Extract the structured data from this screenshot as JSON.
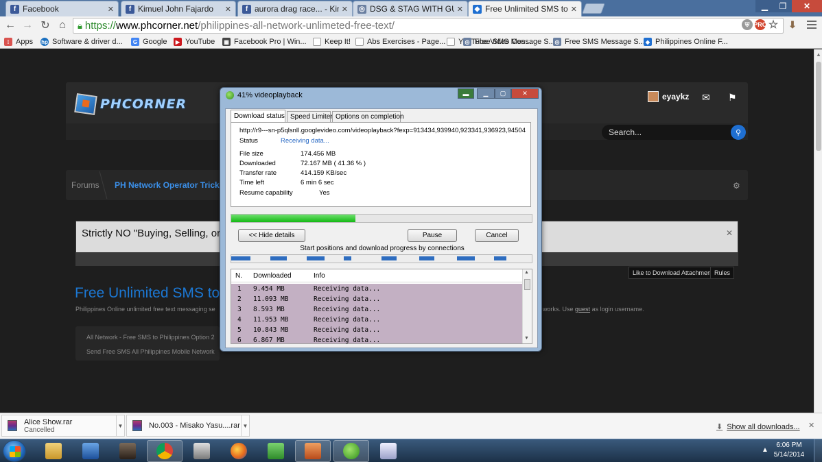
{
  "browser": {
    "tabs": [
      {
        "title": "Facebook",
        "icon": "facebook-icon",
        "color": "#3b5998",
        "glyph": "f"
      },
      {
        "title": "Kimuel John Fajardo",
        "icon": "facebook-icon",
        "color": "#3b5998",
        "glyph": "f"
      },
      {
        "title": "aurora drag race... - Kimue",
        "icon": "facebook-icon",
        "color": "#3b5998",
        "glyph": "f"
      },
      {
        "title": "DSG & STAG WITH GUEST",
        "icon": "globe-icon",
        "color": "#6a7fa0",
        "glyph": "◎"
      },
      {
        "title": "Free Unlimited SMS to All",
        "icon": "phcorner-icon",
        "color": "#1f6fd1",
        "glyph": "◆"
      }
    ],
    "url": {
      "scheme": "https://",
      "host": "www.phcorner.net",
      "path": "/philippines-all-network-unlimeted-free-text/"
    },
    "omnibox_icons": [
      {
        "icon": "shield-extension-icon",
        "label": "",
        "color": "#9a9a9a"
      },
      {
        "icon": "pro-extension-icon",
        "label": "PRO",
        "color": "#d2452f"
      },
      {
        "icon": "star-icon",
        "label": "☆",
        "color": "#9a9a9a"
      }
    ],
    "bookmarks": [
      {
        "label": "Apps",
        "icon": "apps-grid-icon",
        "color": "#d9534f",
        "glyph": "⁞"
      },
      {
        "label": "Software & driver d...",
        "icon": "hp-icon",
        "color": "#1a6fbf",
        "glyph": "hp"
      },
      {
        "label": "Google",
        "icon": "google-icon",
        "color": "#4285f4",
        "glyph": "G"
      },
      {
        "label": "YouTube",
        "icon": "youtube-icon",
        "color": "#cc181e",
        "glyph": "▶"
      },
      {
        "label": "Facebook Pro | Win...",
        "icon": "facebook-pro-icon",
        "color": "#444",
        "glyph": "▦"
      },
      {
        "label": "Keep It!",
        "icon": "page-icon",
        "color": "#ffffff",
        "glyph": ""
      },
      {
        "label": "Abs Exercises - Page...",
        "icon": "page-icon",
        "color": "#ffffff",
        "glyph": ""
      },
      {
        "label": "YouTube Video Con...",
        "icon": "page-icon",
        "color": "#ffffff",
        "glyph": ""
      },
      {
        "label": "Free SMS Message S...",
        "icon": "sms-icon",
        "color": "#6a7fa0",
        "glyph": "◎"
      },
      {
        "label": "Philippines Online F...",
        "icon": "phcorner-icon",
        "color": "#1f6fd1",
        "glyph": "◆"
      }
    ]
  },
  "site": {
    "logo": "PHCORNER",
    "username": "eyaykz",
    "search_placeholder": "Search...",
    "breadcrumb": [
      "Forums",
      "PH Network Operator Tricks"
    ],
    "notice": "Strictly NO \"Buying, Selling, or",
    "chips": [
      "Like to Download Attachment",
      "Rules"
    ],
    "title": "Free Unlimited SMS to",
    "subtitle_left": "Philippines Online unlimited free text messaging se",
    "subtitle_right_prefix": "works. Use",
    "subtitle_right_link": "guest",
    "subtitle_right_suffix": "as login username.",
    "related": [
      "All Network - Free SMS to Philippines Option 2",
      "Send Free SMS All Philippines Mobile Network"
    ]
  },
  "downloader": {
    "title": "41% videoplayback",
    "tabs": [
      "Download status",
      "Speed Limiter",
      "Options on completion"
    ],
    "url": "http://r9---sn-p5qlsnll.googlevideo.com/videoplayback?fexp=913434,939940,923341,936923,94504",
    "status_label": "Status",
    "status_value": "Receiving data...",
    "fields": [
      {
        "label": "File size",
        "value": "174.456  MB"
      },
      {
        "label": "Downloaded",
        "value": "72.167  MB  ( 41.36 % )"
      },
      {
        "label": "Transfer rate",
        "value": "414.159  KB/sec"
      },
      {
        "label": "Time left",
        "value": "6 min 6 sec"
      },
      {
        "label": "Resume capability",
        "value": "Yes"
      }
    ],
    "progress_fraction": 0.4136,
    "buttons": {
      "hide_details": "<< Hide details",
      "pause": "Pause",
      "cancel": "Cancel"
    },
    "connections_label": "Start positions and download progress by connections",
    "connection_segments": [
      {
        "start": 0.0,
        "end": 0.065
      },
      {
        "start": 0.13,
        "end": 0.185
      },
      {
        "start": 0.25,
        "end": 0.31
      },
      {
        "start": 0.375,
        "end": 0.4
      },
      {
        "start": 0.5,
        "end": 0.55
      },
      {
        "start": 0.625,
        "end": 0.675
      },
      {
        "start": 0.75,
        "end": 0.81
      },
      {
        "start": 0.875,
        "end": 0.915
      }
    ],
    "columns": [
      "N.",
      "Downloaded",
      "Info"
    ],
    "rows": [
      {
        "n": "1",
        "downloaded": "9.454 MB",
        "info": "Receiving data..."
      },
      {
        "n": "2",
        "downloaded": "11.093 MB",
        "info": "Receiving data..."
      },
      {
        "n": "3",
        "downloaded": "8.593 MB",
        "info": "Receiving data..."
      },
      {
        "n": "4",
        "downloaded": "11.953 MB",
        "info": "Receiving data..."
      },
      {
        "n": "5",
        "downloaded": "10.843 MB",
        "info": "Receiving data..."
      },
      {
        "n": "6",
        "downloaded": "6.867 MB",
        "info": "Receiving data..."
      }
    ]
  },
  "shelf": {
    "items": [
      {
        "name": "Alice Show.rar",
        "status": "Cancelled"
      },
      {
        "name": "No.003 - Misako Yasu....rar",
        "status": ""
      }
    ],
    "show_all": "Show all downloads..."
  },
  "taskbar": {
    "apps": [
      {
        "name": "explorer",
        "icon": "file-explorer-icon",
        "color": "#d9b14a"
      },
      {
        "name": "tasks",
        "icon": "checkmark-app-icon",
        "color": "#2a66b8"
      },
      {
        "name": "game",
        "icon": "game-app-icon",
        "color": "#4a3a2a"
      },
      {
        "name": "chrome",
        "icon": "chrome-icon",
        "color": "#e0a21a"
      },
      {
        "name": "tool",
        "icon": "toolbox-icon",
        "color": "#8a8a8a"
      },
      {
        "name": "firefox",
        "icon": "firefox-icon",
        "color": "#e66a1e"
      },
      {
        "name": "phone",
        "icon": "green-app-icon",
        "color": "#3fa83a"
      },
      {
        "name": "present",
        "icon": "presentation-icon",
        "color": "#d56a2a"
      },
      {
        "name": "idm",
        "icon": "download-manager-icon",
        "color": "#2e9a2e"
      },
      {
        "name": "paint",
        "icon": "paint-icon",
        "color": "#c8c8d8"
      }
    ],
    "time": "6:06 PM",
    "date": "5/14/2014"
  }
}
